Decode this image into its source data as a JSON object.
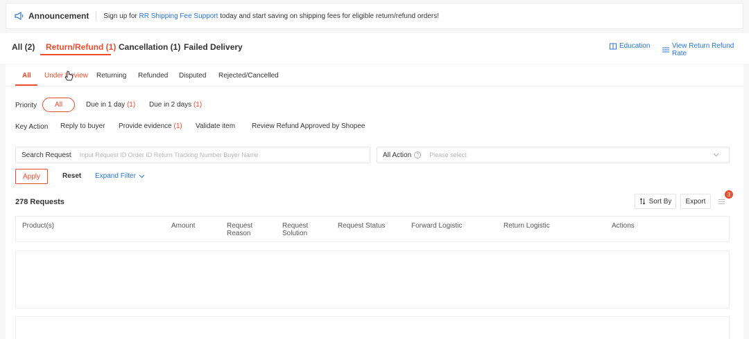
{
  "announcement": {
    "title": "Announcement",
    "text_before": "Sign up for ",
    "link": "RR Shipping Fee Support",
    "text_after": " today and start saving on shipping fees for eligible return/refund orders!"
  },
  "main_tabs": [
    {
      "label": "All (2)"
    },
    {
      "label": "Return/Refund (1)"
    },
    {
      "label": "Cancellation (1)"
    },
    {
      "label": "Failed Delivery"
    }
  ],
  "header_links": {
    "education": "Education",
    "view_rate": "View Return Refund Rate"
  },
  "sub_tabs": [
    {
      "label": "All"
    },
    {
      "label": "Under Review"
    },
    {
      "label": "Returning"
    },
    {
      "label": "Refunded"
    },
    {
      "label": "Disputed"
    },
    {
      "label": "Rejected/Cancelled"
    }
  ],
  "priority": {
    "label": "Priority",
    "all": "All",
    "options": [
      {
        "label": "Due in 1 day",
        "count": "(1)"
      },
      {
        "label": "Due in 2 days",
        "count": "(1)"
      }
    ]
  },
  "key_action": {
    "label": "Key Action",
    "options": [
      {
        "label": "Reply to buyer",
        "count": ""
      },
      {
        "label": "Provide evidence",
        "count": "(1)"
      },
      {
        "label": "Validate item",
        "count": ""
      },
      {
        "label": "Review Refund Approved by Shopee",
        "count": ""
      }
    ]
  },
  "filters": {
    "search_label": "Search Request",
    "search_placeholder": "Input Request ID Order ID Return Tracking Number Buyer Name",
    "action_label": "All Action",
    "action_placeholder": "Please select",
    "apply": "Apply",
    "reset": "Reset",
    "expand": "Expand Filter"
  },
  "results": {
    "count_label": "278 Requests",
    "sort_by": "Sort By",
    "export": "Export",
    "badge": "3"
  },
  "table": {
    "headers": [
      {
        "line1": "Product(s)",
        "line2": ""
      },
      {
        "line1": "Amount",
        "line2": ""
      },
      {
        "line1": "Request",
        "line2": "Reason"
      },
      {
        "line1": "Request",
        "line2": "Solution"
      },
      {
        "line1": "Request Status",
        "line2": ""
      },
      {
        "line1": "Forward Logistic",
        "line2": ""
      },
      {
        "line1": "Return Logistic",
        "line2": ""
      },
      {
        "line1": "Actions",
        "line2": ""
      }
    ]
  },
  "colors": {
    "accent": "#ee4d2d",
    "link": "#2673dd"
  }
}
